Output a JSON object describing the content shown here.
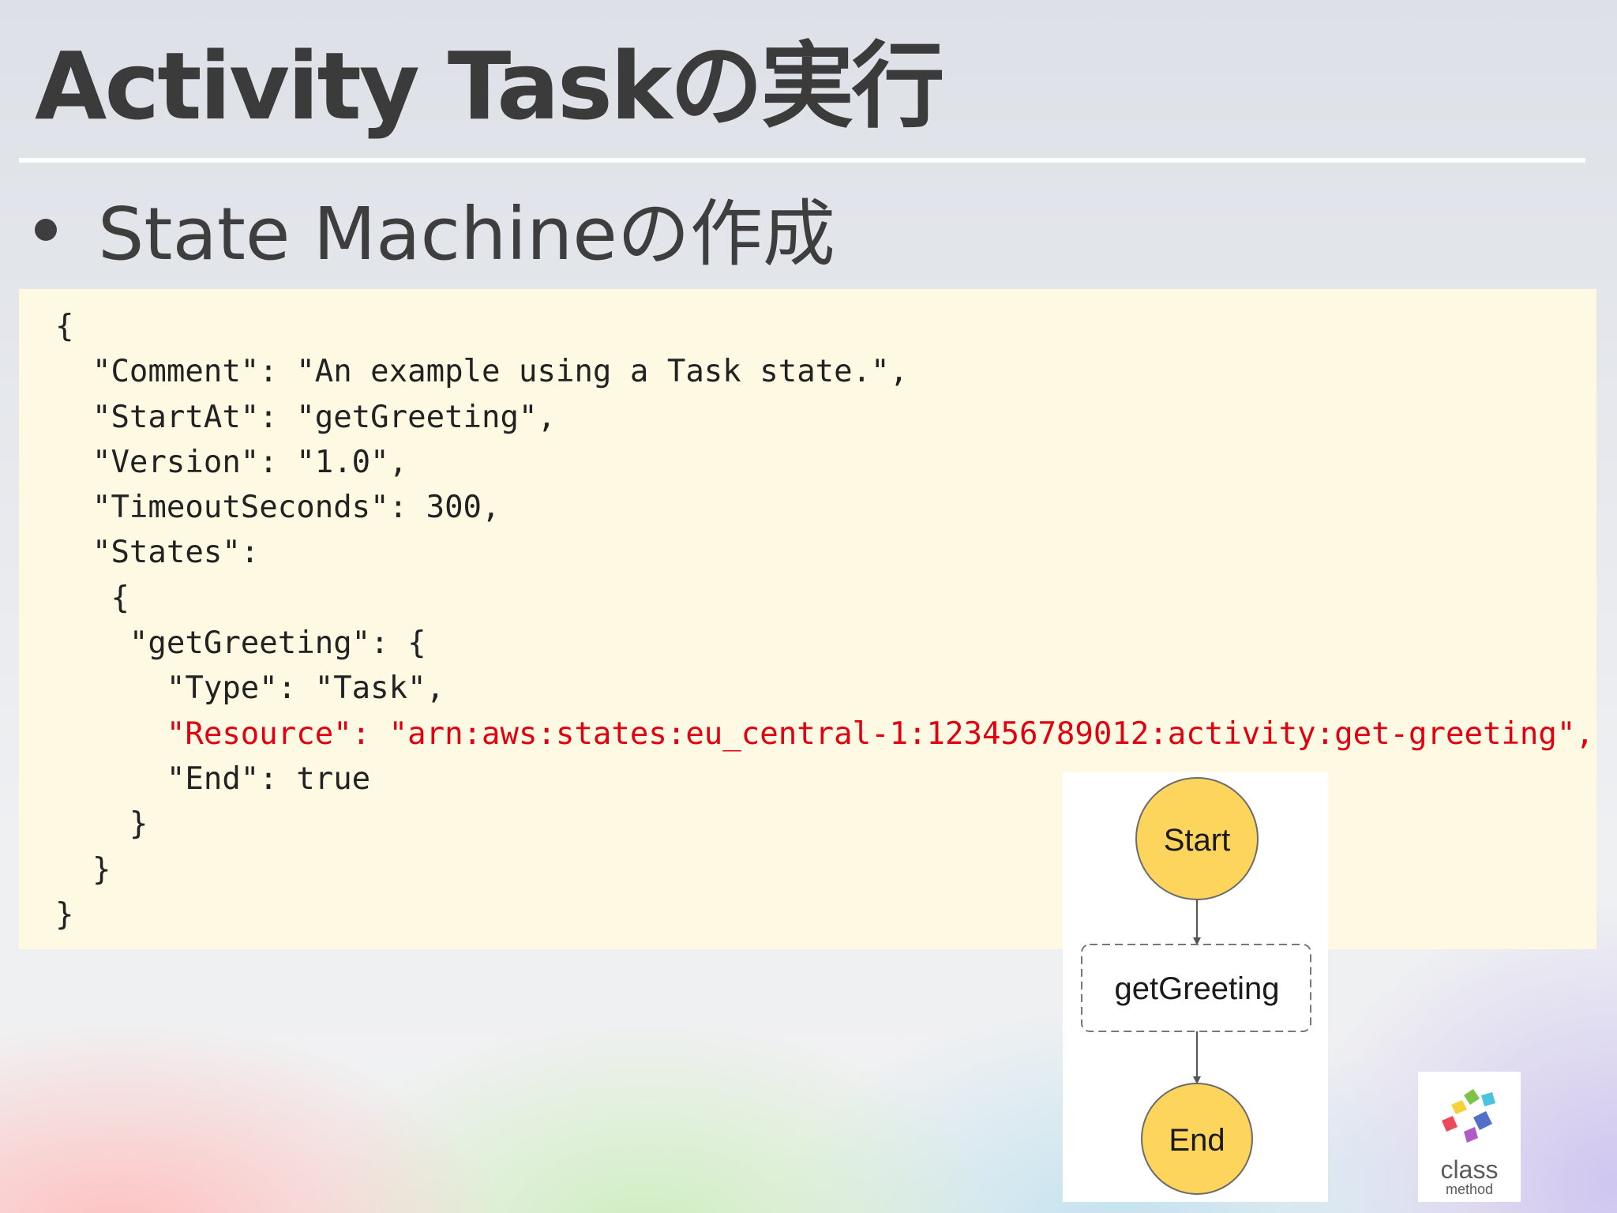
{
  "slide": {
    "title": "Activity Taskの実行",
    "bullet": "State Machineの作成"
  },
  "code": {
    "lines": [
      "{",
      "  \"Comment\": \"An example using a Task state.\",",
      "  \"StartAt\": \"getGreeting\",",
      "  \"Version\": \"1.0\",",
      "  \"TimeoutSeconds\": 300,",
      "  \"States\":",
      "   {",
      "    \"getGreeting\": {",
      "      \"Type\": \"Task\",",
      "      \"Resource\": \"arn:aws:states:eu_central-1:123456789012:activity:get-greeting\",",
      "      \"End\": true",
      "    }",
      "  }",
      "}"
    ],
    "highlight_color": "#e00010"
  },
  "diagram": {
    "start_label": "Start",
    "task_label": "getGreeting",
    "end_label": "End",
    "node_fill": "#fdd45c",
    "node_stroke": "#6b6b6b"
  },
  "logo": {
    "word1": "class",
    "word2": "method"
  }
}
